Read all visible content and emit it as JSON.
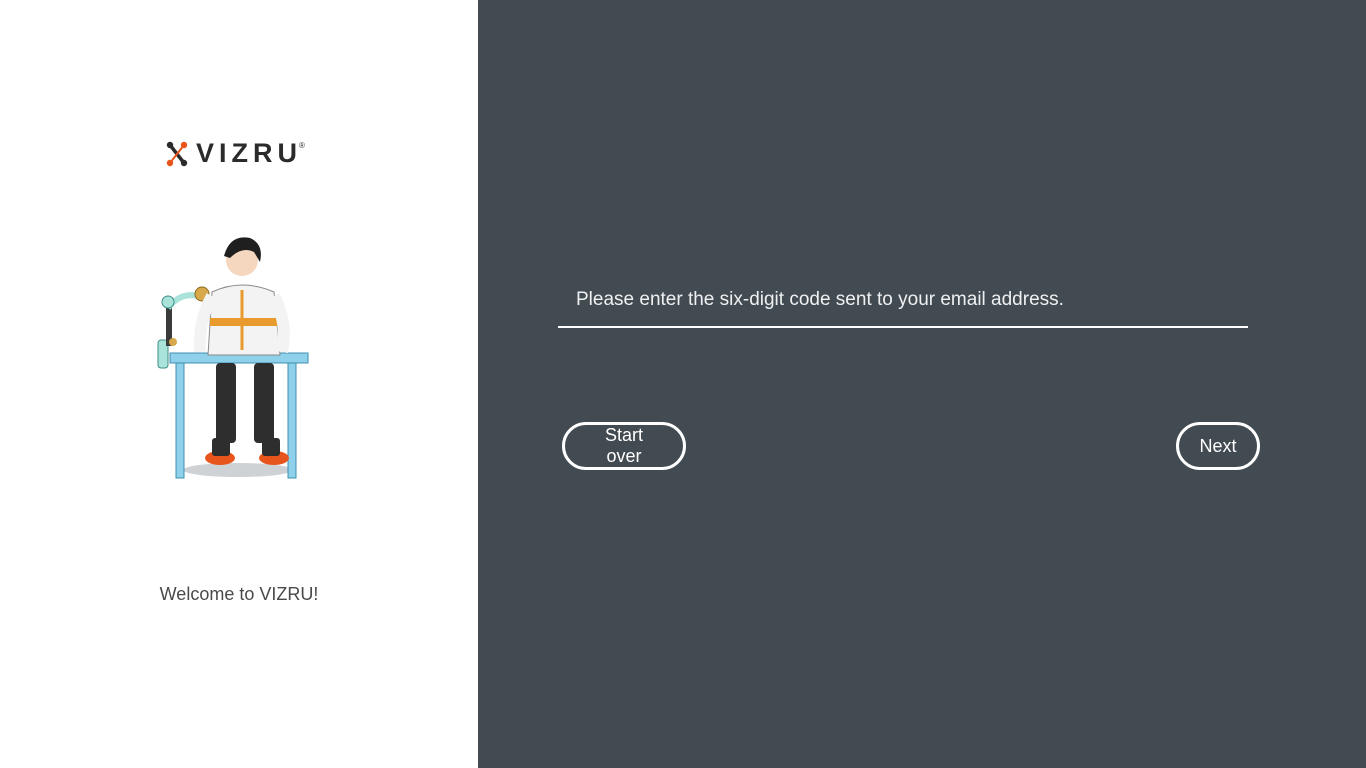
{
  "brand": {
    "name": "VIZRU",
    "registered_mark": "®",
    "accent_colors": [
      "#e8551c",
      "#2b2b2b"
    ]
  },
  "left_panel": {
    "welcome_text": "Welcome to VIZRU!",
    "illustration_icon": "character-at-desk-illustration"
  },
  "form": {
    "code_input": {
      "placeholder": "Please enter the six-digit code sent to your email address.",
      "value": ""
    },
    "start_over_label": "Start over",
    "next_label": "Next"
  },
  "colors": {
    "right_panel_bg": "#434b52",
    "left_panel_bg": "#ffffff",
    "foreground": "#ffffff"
  }
}
